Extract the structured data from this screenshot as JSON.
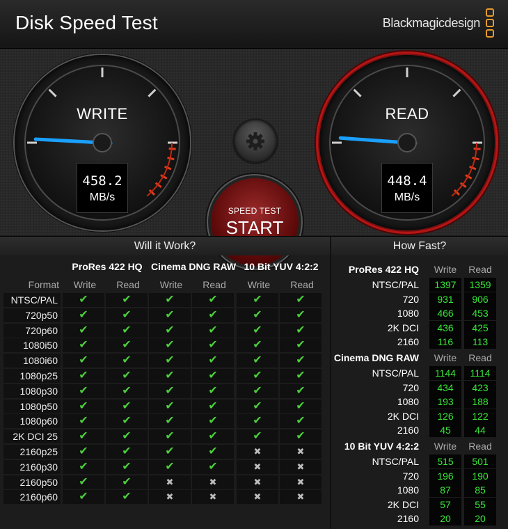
{
  "app": {
    "title": "Disk Speed Test",
    "brand": "Blackmagicdesign"
  },
  "colors": {
    "accent_check": "#4ccf3c",
    "value_green": "#38e638",
    "read_ring": "#b51515",
    "needle": "#1aa0ff"
  },
  "write_gauge": {
    "label": "WRITE",
    "value": "458.2",
    "unit": "MB/s"
  },
  "read_gauge": {
    "label": "READ",
    "value": "448.4",
    "unit": "MB/s"
  },
  "controls": {
    "settings_icon": "gear-icon",
    "start_small": "SPEED TEST",
    "start_big": "START"
  },
  "will_it_work": {
    "title": "Will it Work?",
    "format_header": "Format",
    "groups": [
      {
        "name": "ProRes 422 HQ",
        "sub": [
          "Write",
          "Read"
        ]
      },
      {
        "name": "Cinema DNG RAW",
        "sub": [
          "Write",
          "Read"
        ]
      },
      {
        "name": "10 Bit YUV 4:2:2",
        "sub": [
          "Write",
          "Read"
        ]
      }
    ],
    "rows": [
      {
        "format": "NTSC/PAL",
        "cells": [
          1,
          1,
          1,
          1,
          1,
          1
        ]
      },
      {
        "format": "720p50",
        "cells": [
          1,
          1,
          1,
          1,
          1,
          1
        ]
      },
      {
        "format": "720p60",
        "cells": [
          1,
          1,
          1,
          1,
          1,
          1
        ]
      },
      {
        "format": "1080i50",
        "cells": [
          1,
          1,
          1,
          1,
          1,
          1
        ]
      },
      {
        "format": "1080i60",
        "cells": [
          1,
          1,
          1,
          1,
          1,
          1
        ]
      },
      {
        "format": "1080p25",
        "cells": [
          1,
          1,
          1,
          1,
          1,
          1
        ]
      },
      {
        "format": "1080p30",
        "cells": [
          1,
          1,
          1,
          1,
          1,
          1
        ]
      },
      {
        "format": "1080p50",
        "cells": [
          1,
          1,
          1,
          1,
          1,
          1
        ]
      },
      {
        "format": "1080p60",
        "cells": [
          1,
          1,
          1,
          1,
          1,
          1
        ]
      },
      {
        "format": "2K DCI 25",
        "cells": [
          1,
          1,
          1,
          1,
          1,
          1
        ]
      },
      {
        "format": "2160p25",
        "cells": [
          1,
          1,
          1,
          1,
          0,
          0
        ]
      },
      {
        "format": "2160p30",
        "cells": [
          1,
          1,
          1,
          1,
          0,
          0
        ]
      },
      {
        "format": "2160p50",
        "cells": [
          1,
          1,
          0,
          0,
          0,
          0
        ]
      },
      {
        "format": "2160p60",
        "cells": [
          1,
          1,
          0,
          0,
          0,
          0
        ]
      }
    ]
  },
  "how_fast": {
    "title": "How Fast?",
    "sections": [
      {
        "name": "ProRes 422 HQ",
        "cols": [
          "Write",
          "Read"
        ],
        "rows": [
          {
            "label": "NTSC/PAL",
            "write": "1397",
            "read": "1359"
          },
          {
            "label": "720",
            "write": "931",
            "read": "906"
          },
          {
            "label": "1080",
            "write": "466",
            "read": "453"
          },
          {
            "label": "2K DCI",
            "write": "436",
            "read": "425"
          },
          {
            "label": "2160",
            "write": "116",
            "read": "113"
          }
        ]
      },
      {
        "name": "Cinema DNG RAW",
        "cols": [
          "Write",
          "Read"
        ],
        "rows": [
          {
            "label": "NTSC/PAL",
            "write": "1144",
            "read": "1114"
          },
          {
            "label": "720",
            "write": "434",
            "read": "423"
          },
          {
            "label": "1080",
            "write": "193",
            "read": "188"
          },
          {
            "label": "2K DCI",
            "write": "126",
            "read": "122"
          },
          {
            "label": "2160",
            "write": "45",
            "read": "44"
          }
        ]
      },
      {
        "name": "10 Bit YUV 4:2:2",
        "cols": [
          "Write",
          "Read"
        ],
        "rows": [
          {
            "label": "NTSC/PAL",
            "write": "515",
            "read": "501"
          },
          {
            "label": "720",
            "write": "196",
            "read": "190"
          },
          {
            "label": "1080",
            "write": "87",
            "read": "85"
          },
          {
            "label": "2K DCI",
            "write": "57",
            "read": "55"
          },
          {
            "label": "2160",
            "write": "20",
            "read": "20"
          }
        ]
      }
    ]
  }
}
